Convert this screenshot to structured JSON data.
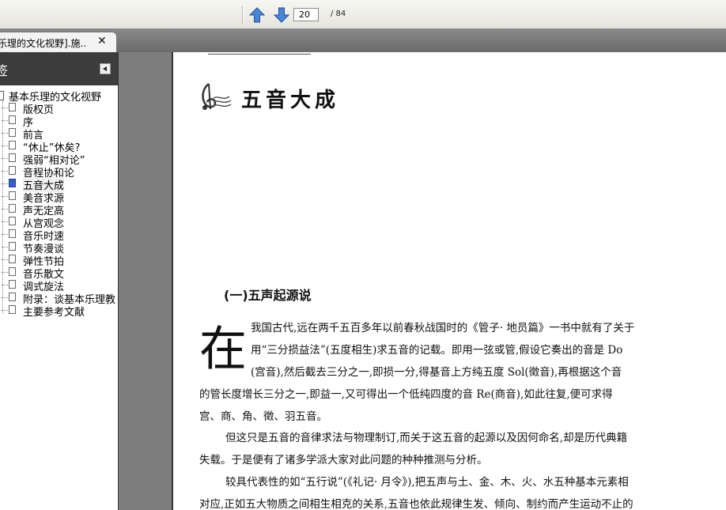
{
  "toolbar": {
    "current_page": "20",
    "total_pages": "/ 84",
    "prev_icon": "arrow-up-icon",
    "next_icon": "arrow-down-icon"
  },
  "tab": {
    "title": "乐理的文化视野].施...",
    "close": "✕"
  },
  "sidebar": {
    "title": "签",
    "root": "基本乐理的文化视野",
    "items": [
      "版权页",
      "序",
      "前言",
      "“休止”休矣?",
      "强弱“相对论”",
      "音程协和论",
      "五音大成",
      "美音求源",
      "声无定高",
      "从宫观念",
      "音乐时速",
      "节奏漫谈",
      "弹性节拍",
      "音乐散文",
      "调式旋法",
      "附录：谈基本乐理教",
      "主要参考文献"
    ],
    "selected_index": 6
  },
  "page": {
    "chapter_title": "五音大成",
    "section_title": "(一)五声起源说",
    "dropcap": "在",
    "lines": [
      "我国古代,远在两千五百多年以前春秋战国时的《管子· 地员篇》一书中就有了关于",
      "用“三分损益法”(五度相生)求五音的记载。即用一弦或管,假设它奏出的音是 Do",
      "(宫音),然后截去三分之一,即损一分,得基音上方纯五度 Sol(徵音),再根据这个音",
      "的管长度增长三分之一,即益一,又可得出一个低纯四度的音 Re(商音),如此往复,便可求得",
      "宫、商、角、徵、羽五音。",
      "但这只是五音的音律求法与物理制订,而关于这五音的起源以及因何命名,却是历代典籍",
      "失载。于是便有了诸多学派大家对此问题的种种推测与分析。",
      "较具代表性的如“五行说”(《礼记· 月令》),把五声与土、金、木、火、水五种基本元素相",
      "对应,正如五大物质之间相生相克的关系,五音也依此规律生发、倾向、制约而产生运动不止的"
    ]
  }
}
